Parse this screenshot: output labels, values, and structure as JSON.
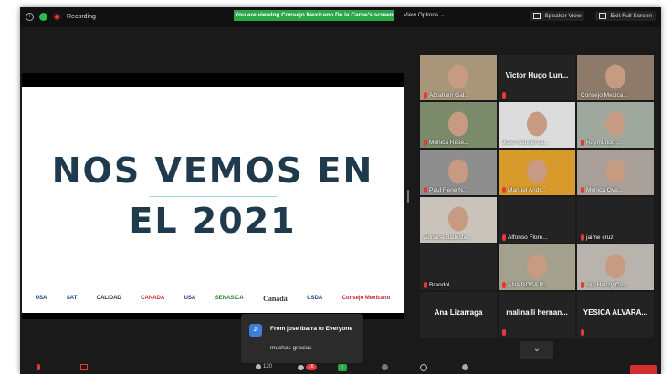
{
  "topbar": {
    "info_glyph": "i",
    "recording_label": "Recording",
    "banner": "You are viewing Consejo Mexicano De la Carne's screen",
    "view_options": "View Options ⌄",
    "speaker_view": "Speaker View",
    "exit_full_screen": "Exit Full Screen"
  },
  "slide": {
    "line1": "NOS VEMOS EN",
    "line2": "EL 2021",
    "logos": [
      "USA",
      "SAT",
      "CALIDAD",
      "CANADA",
      "USA",
      "SENASICA",
      "Canadá",
      "USDA",
      "Consejo Mexicano"
    ]
  },
  "participants": [
    {
      "name": "Abraham Gal...",
      "muted": true,
      "type": "video",
      "bg": "#a9967a"
    },
    {
      "name": "Victor Hugo Lun...",
      "muted": true,
      "type": "name"
    },
    {
      "name": "Consejo Mexica...",
      "muted": false,
      "type": "video",
      "bg": "#8d7a68"
    },
    {
      "name": "Monica Rese...",
      "muted": true,
      "type": "video",
      "bg": "#7a8a6a"
    },
    {
      "name": "Jose manuel sa...",
      "muted": false,
      "type": "video",
      "bg": "#dcdcdc"
    },
    {
      "name": "Raymundo ...",
      "muted": true,
      "type": "video",
      "bg": "#9ea89c"
    },
    {
      "name": "Paul Rene N...",
      "muted": true,
      "type": "video",
      "bg": "#8e8e8e"
    },
    {
      "name": "Manuel Andr...",
      "muted": true,
      "type": "video",
      "bg": "#d89a2a"
    },
    {
      "name": "Monica Ove...",
      "muted": true,
      "type": "video",
      "bg": "#a89f99"
    },
    {
      "name": "Adriana Balleste...",
      "muted": false,
      "type": "video",
      "bg": "#c9c3bc",
      "active": true
    },
    {
      "name": "Alfonso Flore...",
      "muted": true,
      "type": "empty"
    },
    {
      "name": "jaime cruz",
      "muted": true,
      "type": "empty"
    },
    {
      "name": "Brandol",
      "muted": true,
      "type": "empty"
    },
    {
      "name": "ANA ROSA P...",
      "muted": true,
      "type": "video",
      "bg": "#a3a08e"
    },
    {
      "name": "Isis Hanzy Ca...",
      "muted": true,
      "type": "video",
      "bg": "#b9b3ae"
    },
    {
      "name": "Ana Lizarraga",
      "muted": false,
      "type": "name"
    },
    {
      "name": "malinalli hernan...",
      "muted": true,
      "type": "name"
    },
    {
      "name": "YESICA ALVARA...",
      "muted": true,
      "type": "name"
    }
  ],
  "chat": {
    "avatar": "JI",
    "from": "From jose ibarra to Everyone",
    "message": "muchas gracias"
  },
  "toolbar": {
    "participants_count": "120",
    "chat_badge": "16",
    "share_glyph": "↑",
    "expand_glyph": "⌄"
  },
  "colors": {
    "banner": "#2ba84a",
    "slide_text": "#1e3a4c",
    "muted": "#e53935",
    "active_speaker": "#9be34a"
  }
}
